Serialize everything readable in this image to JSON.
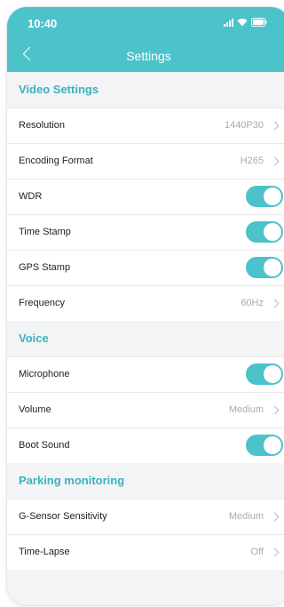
{
  "status_bar": {
    "time": "10:40"
  },
  "header": {
    "title": "Settings"
  },
  "video_settings": {
    "title": "Video Settings",
    "resolution": {
      "label": "Resolution",
      "value": "1440P30"
    },
    "encoding_format": {
      "label": "Encoding Format",
      "value": "H265"
    },
    "wdr": {
      "label": "WDR",
      "on": true
    },
    "time_stamp": {
      "label": "Time Stamp",
      "on": true
    },
    "gps_stamp": {
      "label": "GPS Stamp",
      "on": true
    },
    "frequency": {
      "label": "Frequency",
      "value": "60Hz"
    }
  },
  "voice": {
    "title": "Voice",
    "microphone": {
      "label": "Microphone",
      "on": true
    },
    "volume": {
      "label": "Volume",
      "value": "Medium"
    },
    "boot_sound": {
      "label": "Boot Sound",
      "on": true
    }
  },
  "parking_monitoring": {
    "title": "Parking monitoring",
    "g_sensor": {
      "label": "G-Sensor Sensitivity",
      "value": "Medium"
    },
    "time_lapse": {
      "label": "Time-Lapse",
      "value": "Off"
    }
  },
  "colors": {
    "accent": "#4cc2cb",
    "background": "#f3f4f6"
  }
}
